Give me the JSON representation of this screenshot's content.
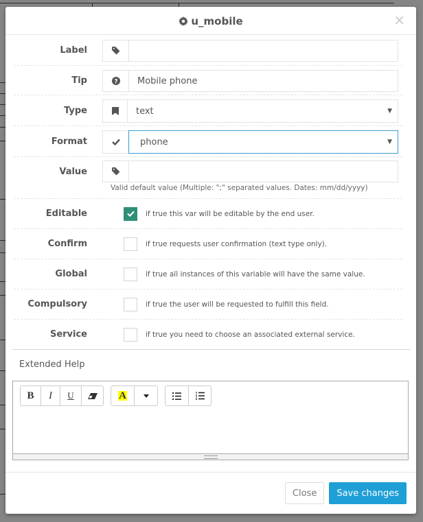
{
  "modal": {
    "title": "u_mobile",
    "title_icon": "gear-icon",
    "close_glyph": "×"
  },
  "fields": {
    "label": {
      "label": "Label",
      "icon": "tag-icon",
      "value": ""
    },
    "tip": {
      "label": "Tip",
      "icon": "question-circle-icon",
      "value": "Mobile phone"
    },
    "type": {
      "label": "Type",
      "icon": "bookmark-icon",
      "value": "text"
    },
    "format": {
      "label": "Format",
      "icon": "check-icon",
      "value": "phone"
    },
    "value": {
      "label": "Value",
      "icon": "tag-icon",
      "value": "",
      "help": "Valid default value (Multiple: \";\" separated values. Dates: mm/dd/yyyy)"
    }
  },
  "options": [
    {
      "label": "Editable",
      "checked": true,
      "description": "if true this var will be editable by the end user."
    },
    {
      "label": "Confirm",
      "checked": false,
      "description": "if true requests user confirmation (text type only)."
    },
    {
      "label": "Global",
      "checked": false,
      "description": "if true all instances of this variable will have the same value."
    },
    {
      "label": "Compulsory",
      "checked": false,
      "description": "if true the user will be requested to fulfill this field."
    },
    {
      "label": "Service",
      "checked": false,
      "description": "if true you need to choose an associated external service."
    }
  ],
  "extended_help": {
    "title": "Extended Help",
    "toolbar": {
      "bold": "B",
      "italic": "I",
      "underline": "U",
      "eraser": "eraser-icon",
      "highlight": "A",
      "highlight_color": "#ffff00",
      "dropdown": "caret-down-icon",
      "ul": "list-ul-icon",
      "ol": "list-ol-icon"
    },
    "content": ""
  },
  "footer": {
    "close_label": "Close",
    "save_label": "Save changes"
  },
  "colors": {
    "primary": "#1e9fd6",
    "checked": "#2f8f77",
    "focus_border": "#3c9bd0"
  }
}
